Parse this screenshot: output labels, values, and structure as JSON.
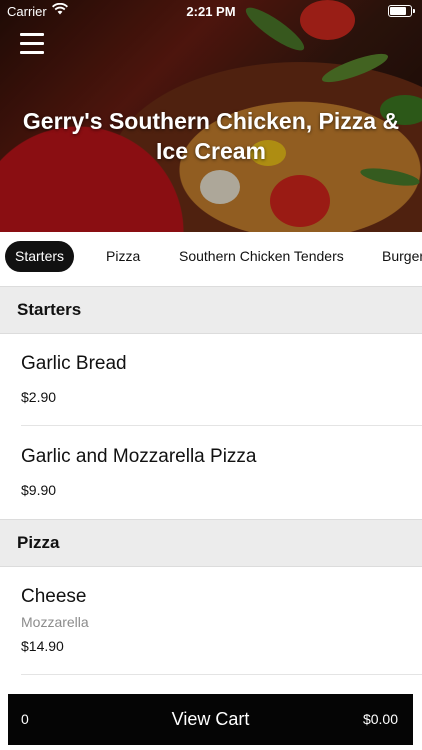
{
  "status_bar": {
    "carrier": "Carrier",
    "time": "2:21 PM"
  },
  "header": {
    "title": "Gerry's Southern Chicken, Pizza & Ice Cream"
  },
  "tabs": [
    {
      "label": "Starters",
      "active": true
    },
    {
      "label": "Pizza",
      "active": false
    },
    {
      "label": "Southern Chicken Tenders",
      "active": false
    },
    {
      "label": "Burger",
      "active": false
    }
  ],
  "sections": [
    {
      "title": "Starters",
      "items": [
        {
          "name": "Garlic Bread",
          "description": "",
          "price": "$2.90"
        },
        {
          "name": "Garlic and Mozzarella Pizza",
          "description": "",
          "price": "$9.90"
        }
      ]
    },
    {
      "title": "Pizza",
      "items": [
        {
          "name": "Cheese",
          "description": "Mozzarella",
          "price": "$14.90"
        }
      ]
    }
  ],
  "cart": {
    "count": "0",
    "label": "View Cart",
    "total": "$0.00"
  },
  "colors": {
    "tab_active_bg": "#111111",
    "cart_bg": "#050505",
    "section_bg": "#ececec"
  }
}
